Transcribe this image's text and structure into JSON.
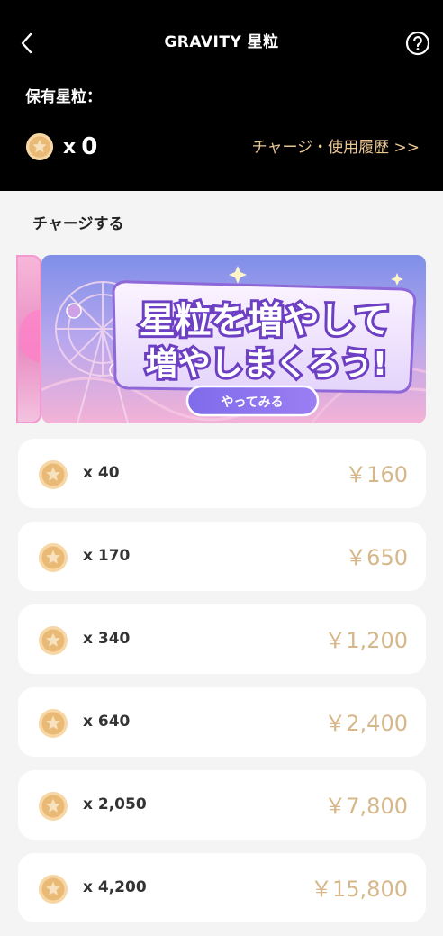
{
  "header": {
    "title": "GRAVITY 星粒",
    "balance_label": "保有星粒：",
    "balance_prefix": "x",
    "balance_value": "0",
    "history_link": "チャージ・使用履歴 >>"
  },
  "charge": {
    "section_title": "チャージする",
    "banner": {
      "line1": "星粒を増やして",
      "line2": "増やしまくろう!",
      "button_label": "やってみる"
    }
  },
  "packages": [
    {
      "quantity": "x 40",
      "price": "￥160"
    },
    {
      "quantity": "x 170",
      "price": "￥650"
    },
    {
      "quantity": "x 340",
      "price": "￥1,200"
    },
    {
      "quantity": "x 640",
      "price": "￥2,400"
    },
    {
      "quantity": "x 2,050",
      "price": "￥7,800"
    },
    {
      "quantity": "x 4,200",
      "price": "￥15,800"
    }
  ],
  "icons": {
    "back": "chevron-left-icon",
    "help": "question-circle-icon",
    "coin": "star-coin-icon"
  },
  "colors": {
    "header_bg": "#000000",
    "history_link": "#e9c692",
    "price": "#d6b78a",
    "coin": "#f3c98b"
  }
}
